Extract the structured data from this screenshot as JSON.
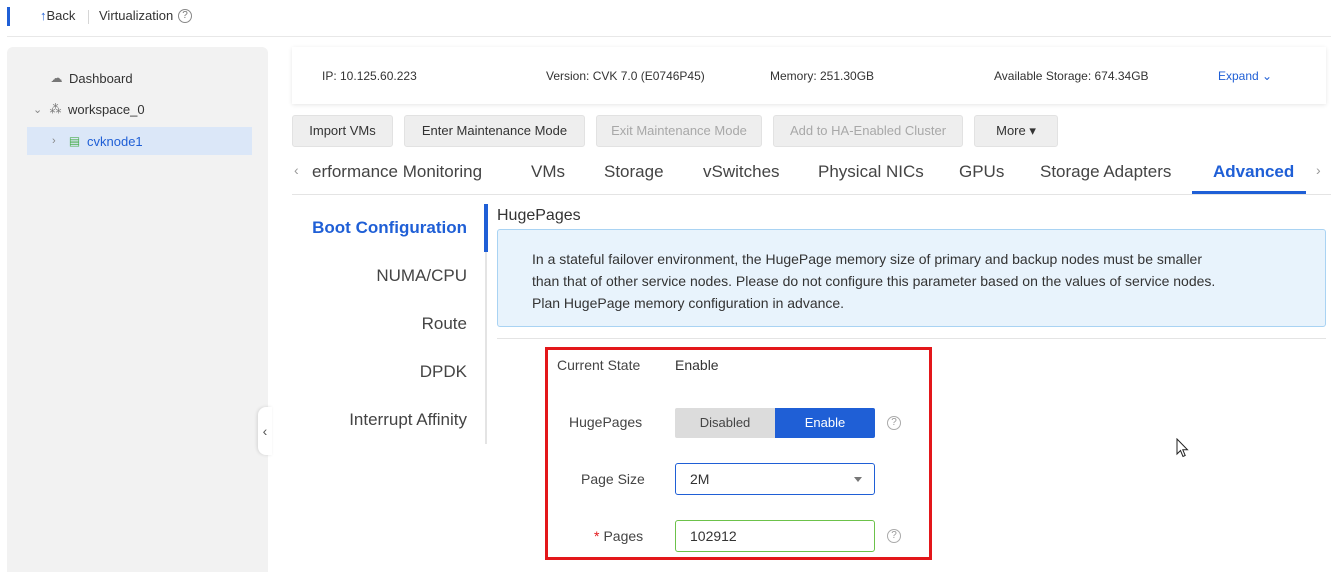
{
  "topbar": {
    "back_label": "Back",
    "back_icon": "up-arrow-icon",
    "breadcrumb": "Virtualization",
    "help_glyph": "?"
  },
  "sidebar": {
    "items": [
      {
        "label": "Dashboard",
        "icon": "cloud-icon"
      },
      {
        "label": "workspace_0",
        "icon": "cluster-icon",
        "expanded": true
      },
      {
        "label": "cvknode1",
        "icon": "host-icon",
        "selected": true
      }
    ],
    "collapse_glyph": "‹"
  },
  "info": {
    "ip": "IP: 10.125.60.223",
    "version": "Version: CVK 7.0 (E0746P45)",
    "memory": "Memory: 251.30GB",
    "storage": "Available Storage: 674.34GB",
    "expand_label": "Expand ⌄"
  },
  "actions": {
    "import_vms": "Import VMs",
    "enter_maintenance": "Enter Maintenance Mode",
    "exit_maintenance": "Exit Maintenance Mode",
    "add_ha": "Add to HA-Enabled Cluster",
    "more": "More ▾"
  },
  "tabs": [
    "erformance Monitoring",
    "VMs",
    "Storage",
    "vSwitches",
    "Physical NICs",
    "GPUs",
    "Storage Adapters",
    "Advanced"
  ],
  "tab_active": "Advanced",
  "submenu": {
    "items": [
      "Boot Configuration",
      "NUMA/CPU",
      "Route",
      "DPDK",
      "Interrupt Affinity"
    ],
    "active": "Boot Configuration"
  },
  "hugepages": {
    "title": "HugePages",
    "notice": "In a stateful failover environment, the HugePage memory size of primary and backup nodes must be smaller than that of other service nodes. Please do not configure this parameter based on the values of service nodes. Plan HugePage memory configuration in advance.",
    "current_state_label": "Current State",
    "current_state_value": "Enable",
    "hugepages_label": "HugePages",
    "toggle_off": "Disabled",
    "toggle_on": "Enable",
    "toggle_selected": "Enable",
    "page_size_label": "Page Size",
    "page_size_value": "2M",
    "pages_label": "Pages",
    "pages_required_mark": "*",
    "pages_value": "102912",
    "help_glyph": "?"
  },
  "colors": {
    "accent": "#1f5fd6",
    "highlight_border": "#e3171a",
    "valid_border": "#6cc24a",
    "notice_bg": "#e8f3fc"
  }
}
